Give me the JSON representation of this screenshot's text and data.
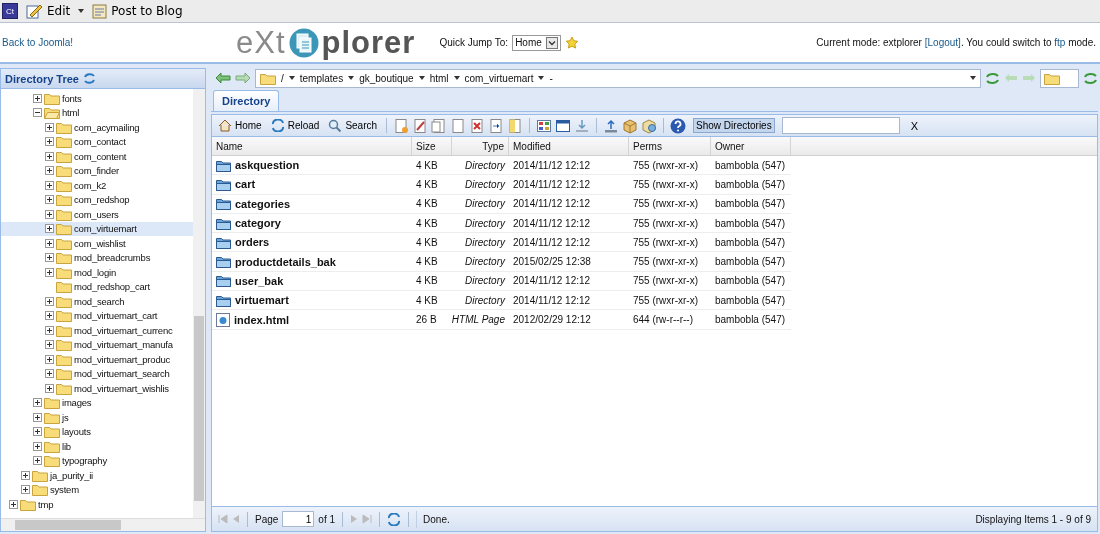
{
  "app_bar": {
    "app_icon": "Ct",
    "edit": "Edit",
    "post": "Post to Blog"
  },
  "header": {
    "back_link": "Back to Joomla!",
    "logo_left": "eXt",
    "logo_right": "plorer",
    "quick_jump_label": "Quick Jump To:",
    "quick_jump_value": "Home",
    "mode": {
      "prefix": "Current mode: extplorer",
      "logout": "[Logout]",
      "middle": ". You could switch to",
      "ftp": "ftp",
      "suffix": "mode."
    }
  },
  "tree": {
    "title": "Directory Tree",
    "items": [
      {
        "children": [
          {
            "children": [
              {
                "label": "fonts",
                "has_children": true,
                "expanded": false,
                "selected": false
              },
              {
                "label": "html",
                "has_children": true,
                "expanded": true,
                "selected": false,
                "children": [
                  {
                    "label": "com_acymailing",
                    "has_children": true,
                    "expanded": false,
                    "selected": false
                  },
                  {
                    "label": "com_contact",
                    "has_children": true,
                    "expanded": false,
                    "selected": false
                  },
                  {
                    "label": "com_content",
                    "has_children": true,
                    "expanded": false,
                    "selected": false
                  },
                  {
                    "label": "com_finder",
                    "has_children": true,
                    "expanded": false,
                    "selected": false
                  },
                  {
                    "label": "com_k2",
                    "has_children": true,
                    "expanded": false,
                    "selected": false
                  },
                  {
                    "label": "com_redshop",
                    "has_children": true,
                    "expanded": false,
                    "selected": false
                  },
                  {
                    "label": "com_users",
                    "has_children": true,
                    "expanded": false,
                    "selected": false
                  },
                  {
                    "label": "com_virtuemart",
                    "has_children": true,
                    "expanded": false,
                    "selected": true
                  },
                  {
                    "label": "com_wishlist",
                    "has_children": true,
                    "expanded": false,
                    "selected": false
                  },
                  {
                    "label": "mod_breadcrumbs",
                    "has_children": true,
                    "expanded": false,
                    "selected": false
                  },
                  {
                    "label": "mod_login",
                    "has_children": true,
                    "expanded": false,
                    "selected": false
                  },
                  {
                    "label": "mod_redshop_cart",
                    "has_children": false,
                    "expanded": false,
                    "selected": false
                  },
                  {
                    "label": "mod_search",
                    "has_children": true,
                    "expanded": false,
                    "selected": false
                  },
                  {
                    "label": "mod_virtuemart_cart",
                    "has_children": true,
                    "expanded": false,
                    "selected": false
                  },
                  {
                    "label": "mod_virtuemart_currenc",
                    "has_children": true,
                    "expanded": false,
                    "selected": false
                  },
                  {
                    "label": "mod_virtuemart_manufa",
                    "has_children": true,
                    "expanded": false,
                    "selected": false
                  },
                  {
                    "label": "mod_virtuemart_produc",
                    "has_children": true,
                    "expanded": false,
                    "selected": false
                  },
                  {
                    "label": "mod_virtuemart_search",
                    "has_children": true,
                    "expanded": false,
                    "selected": false
                  },
                  {
                    "label": "mod_virtuemart_wishlis",
                    "has_children": true,
                    "expanded": false,
                    "selected": false
                  }
                ]
              },
              {
                "label": "images",
                "has_children": true,
                "expanded": false,
                "selected": false
              },
              {
                "label": "js",
                "has_children": true,
                "expanded": false,
                "selected": false
              },
              {
                "label": "layouts",
                "has_children": true,
                "expanded": false,
                "selected": false
              },
              {
                "label": "lib",
                "has_children": true,
                "expanded": false,
                "selected": false
              },
              {
                "label": "typography",
                "has_children": true,
                "expanded": false,
                "selected": false
              }
            ]
          },
          {
            "label": "ja_purity_ii",
            "has_children": true,
            "expanded": false,
            "selected": false
          },
          {
            "label": "system",
            "has_children": true,
            "expanded": false,
            "selected": false
          }
        ]
      },
      {
        "label": "tmp",
        "has_children": true,
        "expanded": false,
        "selected": false
      }
    ]
  },
  "path": {
    "root": "/",
    "crumbs": [
      "templates",
      "gk_boutique",
      "html",
      "com_virtuemart"
    ],
    "tail": "-"
  },
  "tabs": [
    {
      "label": "Directory",
      "selected": true
    }
  ],
  "toolbar": {
    "home": "Home",
    "reload": "Reload",
    "search": "Search",
    "show_directories": {
      "label": "Show Directories",
      "selected": true
    },
    "clear": "X"
  },
  "table": {
    "columns": [
      "Name",
      "Size",
      "Type",
      "Modified",
      "Perms",
      "Owner"
    ],
    "rows": [
      {
        "kind": "directory",
        "name": "askquestion",
        "size": "4 KB",
        "type": "Directory",
        "modified": "2014/11/12 12:12",
        "perms": "755 (rwxr-xr-x)",
        "owner": "bambobla (547)"
      },
      {
        "kind": "directory",
        "name": "cart",
        "size": "4 KB",
        "type": "Directory",
        "modified": "2014/11/12 12:12",
        "perms": "755 (rwxr-xr-x)",
        "owner": "bambobla (547)"
      },
      {
        "kind": "directory",
        "name": "categories",
        "size": "4 KB",
        "type": "Directory",
        "modified": "2014/11/12 12:12",
        "perms": "755 (rwxr-xr-x)",
        "owner": "bambobla (547)"
      },
      {
        "kind": "directory",
        "name": "category",
        "size": "4 KB",
        "type": "Directory",
        "modified": "2014/11/12 12:12",
        "perms": "755 (rwxr-xr-x)",
        "owner": "bambobla (547)"
      },
      {
        "kind": "directory",
        "name": "orders",
        "size": "4 KB",
        "type": "Directory",
        "modified": "2014/11/12 12:12",
        "perms": "755 (rwxr-xr-x)",
        "owner": "bambobla (547)"
      },
      {
        "kind": "directory",
        "name": "productdetails_bak",
        "size": "4 KB",
        "type": "Directory",
        "modified": "2015/02/25 12:38",
        "perms": "755 (rwxr-xr-x)",
        "owner": "bambobla (547)"
      },
      {
        "kind": "directory",
        "name": "user_bak",
        "size": "4 KB",
        "type": "Directory",
        "modified": "2014/11/12 12:12",
        "perms": "755 (rwxr-xr-x)",
        "owner": "bambobla (547)"
      },
      {
        "kind": "directory",
        "name": "virtuemart",
        "size": "4 KB",
        "type": "Directory",
        "modified": "2014/11/12 12:12",
        "perms": "755 (rwxr-xr-x)",
        "owner": "bambobla (547)"
      },
      {
        "kind": "file",
        "name": "index.html",
        "size": "26 B",
        "type": "HTML Page",
        "modified": "2012/02/29 12:12",
        "perms": "644 (rw-r--r--)",
        "owner": "bambobla (547)"
      }
    ]
  },
  "pager": {
    "page_label": "Page",
    "page": "1",
    "of": "of 1",
    "status": "Done.",
    "summary": "Displaying Items 1 - 9 of 9"
  }
}
